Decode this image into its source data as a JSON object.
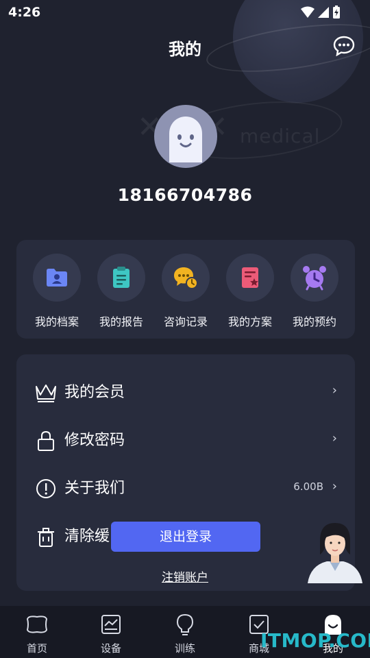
{
  "status_bar": {
    "time": "4:26"
  },
  "header": {
    "title": "我的"
  },
  "background": {
    "brand_text": "medical"
  },
  "profile": {
    "phone": "18166704786"
  },
  "quick_actions": [
    {
      "label": "我的档案",
      "icon": "profile-folder-icon",
      "color": "#6b86f5"
    },
    {
      "label": "我的报告",
      "icon": "clipboard-icon",
      "color": "#3ec7c3"
    },
    {
      "label": "咨询记录",
      "icon": "chat-clock-icon",
      "color": "#f2b321"
    },
    {
      "label": "我的方案",
      "icon": "plan-document-icon",
      "color": "#ec5b78"
    },
    {
      "label": "我的预约",
      "icon": "alarm-clock-icon",
      "color": "#a57af0"
    }
  ],
  "menu": [
    {
      "label": "我的会员",
      "icon": "crown-icon",
      "value": "",
      "chevron": "›"
    },
    {
      "label": "修改密码",
      "icon": "lock-icon",
      "value": "",
      "chevron": "›"
    },
    {
      "label": "关于我们",
      "icon": "info-icon",
      "value": "6.00B",
      "chevron": "›"
    },
    {
      "label": "清除缓",
      "icon": "trash-icon",
      "value": "",
      "chevron": ""
    }
  ],
  "actions": {
    "logout_label": "退出登录",
    "cancel_account_label": "注销账户"
  },
  "tabs": [
    {
      "label": "首页",
      "icon": "home-icon",
      "active": false
    },
    {
      "label": "设备",
      "icon": "device-chart-icon",
      "active": false
    },
    {
      "label": "训练",
      "icon": "lightbulb-icon",
      "active": false
    },
    {
      "label": "商城",
      "icon": "checkbox-icon",
      "active": false
    },
    {
      "label": "我的",
      "icon": "profile-ghost-icon",
      "active": true
    }
  ],
  "watermark": {
    "text": "ITMOP.COM"
  },
  "colors": {
    "background": "#1f222f",
    "card": "#282c3d",
    "accent": "#5267f2",
    "tabbar": "#171923"
  }
}
